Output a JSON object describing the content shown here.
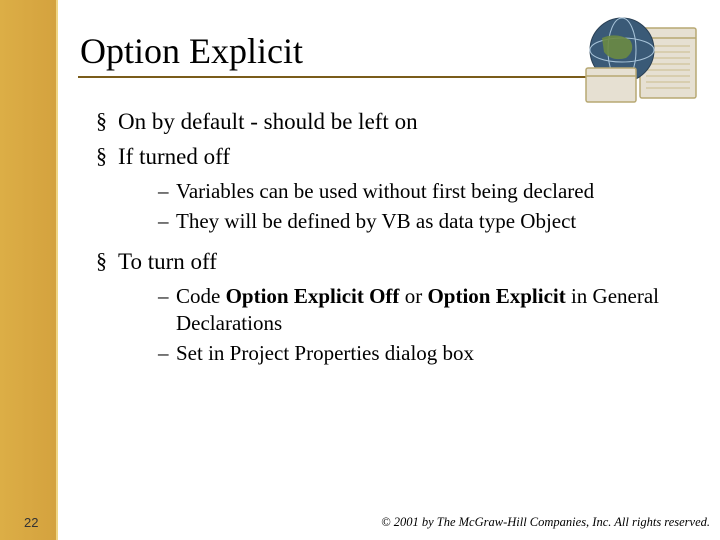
{
  "title": "Option Explicit",
  "bullets": [
    {
      "text": "On by default - should be left on"
    },
    {
      "text": "If turned off",
      "sub": [
        "Variables can be used without first being declared",
        "They will be defined by VB as data type Object"
      ]
    },
    {
      "text": "To turn off",
      "sub_rich": [
        {
          "prefix": "Code ",
          "bold1": "Option Explicit Off",
          "mid": "  or ",
          "bold2": "Option Explicit",
          "suffix": " in General Declarations"
        },
        {
          "plain": "Set in Project Properties dialog box"
        }
      ]
    }
  ],
  "page_number": "22",
  "copyright": "© 2001 by The McGraw-Hill Companies, Inc. All rights reserved."
}
